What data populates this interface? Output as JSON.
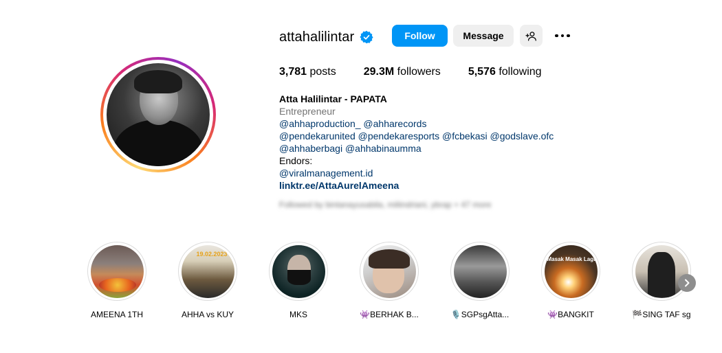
{
  "profile": {
    "username": "attahalilintar",
    "verified": true,
    "buttons": {
      "follow_label": "Follow",
      "message_label": "Message",
      "add_user_icon": "person-add-icon",
      "more_icon": "more-horizontal-icon"
    },
    "stats": {
      "posts_count": "3,781",
      "posts_label": "posts",
      "followers_count": "29.3M",
      "followers_label": "followers",
      "following_count": "5,576",
      "following_label": "following"
    },
    "bio": {
      "name": "Atta Halilintar - PAPATA",
      "category": "Entrepreneur",
      "line1": "@ahhaproduction_ @ahharecords",
      "line2": "@pendekarunited @pendekaresports @fcbekasi @godslave.ofc",
      "line3": "@ahhaberbagi @ahhabinaumma",
      "line4": "Endors:",
      "line5": "@viralmanagement.id",
      "link": "linktr.ee/AttaAurelAmeena"
    },
    "followed_by": "Followed by bintanayusabila, miliindriani, ybrap + 47 more"
  },
  "highlights": [
    {
      "label": "AMEENA 1TH"
    },
    {
      "label": "AHHA vs KUY",
      "image_text": "19.02.2023"
    },
    {
      "label": "MKS"
    },
    {
      "label": "👾BERHAK B..."
    },
    {
      "label": "🎙️SGPsgAtta..."
    },
    {
      "label": "👾BANGKIT",
      "image_text": "Masak Masak Lagu"
    },
    {
      "label": "🏁SING TAF sg"
    }
  ],
  "colors": {
    "follow_button": "#0095f6",
    "secondary_button": "#efefef",
    "mention_link": "#00376b",
    "muted_text": "#737373"
  }
}
